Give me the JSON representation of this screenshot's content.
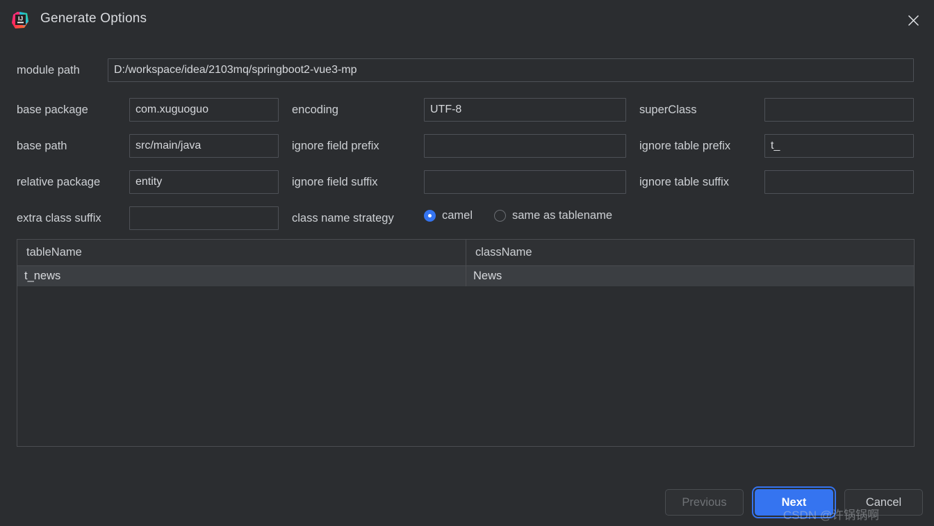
{
  "window": {
    "title": "Generate Options",
    "app_icon": "intellij-idea-icon",
    "close_icon": "close-icon"
  },
  "form": {
    "module_path": {
      "label": "module path",
      "value": "D:/workspace/idea/2103mq/springboot2-vue3-mp",
      "placeholder": ""
    },
    "rows": [
      {
        "col1": {
          "label": "base package",
          "value": "com.xuguoguo",
          "placeholder": ""
        },
        "col2": {
          "label": "encoding",
          "value": "UTF-8",
          "placeholder": ""
        },
        "col3": {
          "label": "superClass",
          "value": "",
          "placeholder": ""
        }
      },
      {
        "col1": {
          "label": "base path",
          "value": "src/main/java",
          "placeholder": ""
        },
        "col2": {
          "label": "ignore field prefix",
          "value": "",
          "placeholder": ""
        },
        "col3": {
          "label": "ignore table prefix",
          "value": "t_",
          "placeholder": ""
        }
      },
      {
        "col1": {
          "label": "relative package",
          "value": "entity",
          "placeholder": ""
        },
        "col2": {
          "label": "ignore field suffix",
          "value": "",
          "placeholder": ""
        },
        "col3": {
          "label": "ignore table suffix",
          "value": "",
          "placeholder": ""
        }
      }
    ],
    "extra_class_suffix": {
      "label": "extra class suffix",
      "value": "",
      "placeholder": ""
    },
    "class_name_strategy": {
      "label": "class name strategy",
      "selected": "camel",
      "options": [
        {
          "value": "camel",
          "label": "camel",
          "checked": true
        },
        {
          "value": "same_as_tablename",
          "label": "same as tablename",
          "checked": false
        }
      ]
    }
  },
  "table": {
    "columns": [
      "tableName",
      "className"
    ],
    "rows": [
      {
        "tableName": "t_news",
        "className": "News",
        "selected": true
      }
    ]
  },
  "footer": {
    "previous_label": "Previous",
    "next_label": "Next",
    "cancel_label": "Cancel"
  },
  "watermark": {
    "text": "CSDN @许锅锅啊"
  },
  "colors": {
    "background": "#2b2d30",
    "accent": "#3574f0",
    "text": "#cdd0d4",
    "disabled_text": "#6f7276",
    "border": "#4e5157",
    "row_selected": "#3b3e42"
  }
}
